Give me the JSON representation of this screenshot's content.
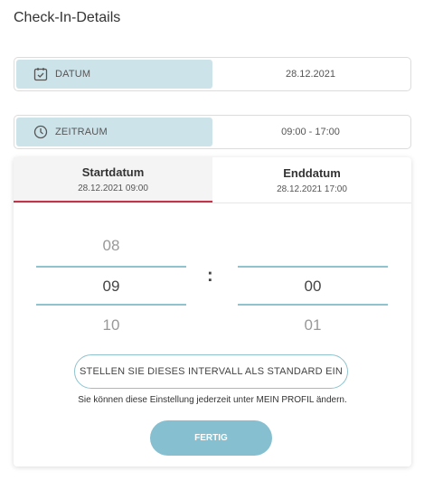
{
  "page": {
    "title": "Check-In-Details"
  },
  "fields": {
    "datum": {
      "label": "DATUM",
      "value": "28.12.2021",
      "icon": "calendar-check-icon"
    },
    "zeitraum": {
      "label": "ZEITRAUM",
      "value": "09:00 - 17:00",
      "icon": "clock-icon"
    }
  },
  "picker": {
    "tabs": [
      {
        "title": "Startdatum",
        "subtitle": "28.12.2021 09:00",
        "active": true
      },
      {
        "title": "Enddatum",
        "subtitle": "28.12.2021 17:00",
        "active": false
      }
    ],
    "hours": {
      "prev": "08",
      "current": "09",
      "next": "10"
    },
    "minutes": {
      "prev": "",
      "current": "00",
      "next": "01"
    },
    "separator": ":",
    "default_button_label": "STELLEN SIE DIESES INTERVALL ALS STANDARD EIN",
    "hint": "Sie können diese Einstellung jederzeit unter MEIN PROFIL ändern.",
    "done_button_label": "FERTIG"
  },
  "colors": {
    "accent": "#86bfcf",
    "label_bg": "#cde3ea",
    "active_tab_underline": "#c0354b"
  }
}
